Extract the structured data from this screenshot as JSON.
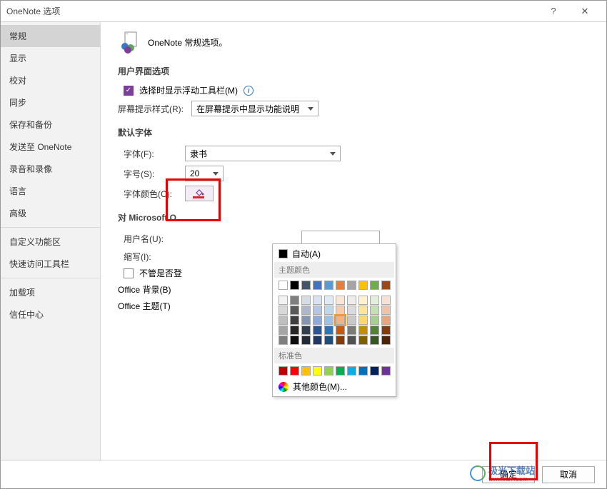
{
  "titlebar": {
    "title": "OneNote 选项",
    "help": "?",
    "close": "✕"
  },
  "sidebar": {
    "items": [
      {
        "label": "常规",
        "active": true
      },
      {
        "label": "显示"
      },
      {
        "label": "校对"
      },
      {
        "label": "同步"
      },
      {
        "label": "保存和备份"
      },
      {
        "label": "发送至 OneNote"
      },
      {
        "label": "录音和录像"
      },
      {
        "label": "语言"
      },
      {
        "label": "高级"
      }
    ],
    "items2": [
      {
        "label": "自定义功能区"
      },
      {
        "label": "快速访问工具栏"
      }
    ],
    "items3": [
      {
        "label": "加载项"
      },
      {
        "label": "信任中心"
      }
    ]
  },
  "header": {
    "title": "OneNote 常规选项。"
  },
  "sections": {
    "ui": "用户界面选项",
    "font": "默认字体",
    "office": "对 Microsoft O"
  },
  "ui_options": {
    "mini_toolbar": "选择时显示浮动工具栏(M)",
    "screentip_label": "屏幕提示样式(R):",
    "screentip_value": "在屏幕提示中显示功能说明"
  },
  "font": {
    "font_label": "字体(F):",
    "font_value": "隶书",
    "size_label": "字号(S):",
    "size_value": "20",
    "color_label": "字体颜色(C):"
  },
  "office": {
    "username_label": "用户名(U):",
    "initials_label": "缩写(I):",
    "always_checkbox": "不管是否登",
    "always_suffix": ")。",
    "background_label": "Office 背景(B)",
    "theme_label": "Office 主题(T)"
  },
  "color_popup": {
    "auto": "自动(A)",
    "theme": "主题颜色",
    "standard": "标准色",
    "more": "其他颜色(M)...",
    "theme_row1": [
      "#ffffff",
      "#000000",
      "#44546a",
      "#4472c4",
      "#5b9bd5",
      "#ed7d31",
      "#a5a5a5",
      "#ffc000",
      "#70ad47",
      "#9e480e"
    ],
    "theme_shades": [
      [
        "#f2f2f2",
        "#7f7f7f",
        "#d6dce4",
        "#d9e2f3",
        "#deebf6",
        "#fbe5d5",
        "#ededed",
        "#fff2cc",
        "#e2efd9",
        "#f7e1d5"
      ],
      [
        "#d8d8d8",
        "#595959",
        "#adb9ca",
        "#b4c6e7",
        "#bdd7ee",
        "#f7cbac",
        "#dbdbdb",
        "#fee599",
        "#c5e0b3",
        "#f0c3a8"
      ],
      [
        "#bfbfbf",
        "#3f3f3f",
        "#8496b0",
        "#8eaadb",
        "#9cc3e5",
        "#f4b183",
        "#c9c9c9",
        "#ffd965",
        "#a8d08d",
        "#e8a57b"
      ],
      [
        "#a5a5a5",
        "#262626",
        "#323f4f",
        "#2f5496",
        "#2e75b5",
        "#c55a11",
        "#7b7b7b",
        "#bf9000",
        "#538135",
        "#833c0b"
      ],
      [
        "#7f7f7f",
        "#0c0c0c",
        "#222a35",
        "#1f3864",
        "#1e4e79",
        "#833c0b",
        "#525252",
        "#7f6000",
        "#375623",
        "#4d2407"
      ]
    ],
    "standard_colors": [
      "#c00000",
      "#ff0000",
      "#ffc000",
      "#ffff00",
      "#92d050",
      "#00b050",
      "#00b0f0",
      "#0070c0",
      "#002060",
      "#7030a0"
    ],
    "selected_index": {
      "row": 2,
      "col": 5
    }
  },
  "footer": {
    "ok": "确定",
    "cancel": "取消"
  },
  "watermark": {
    "text": "极光下载站",
    "sub": "www.xz7.com"
  }
}
